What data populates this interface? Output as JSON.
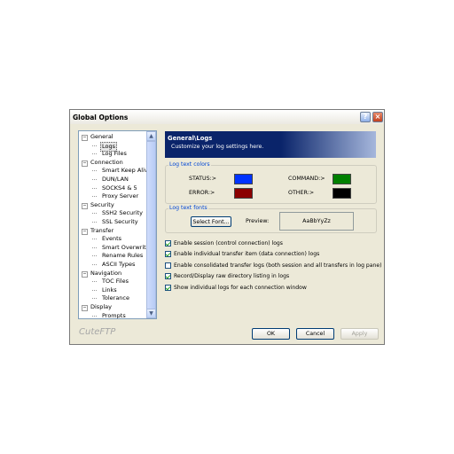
{
  "window": {
    "title": "Global Options",
    "help_label": "?",
    "close_label": "×"
  },
  "tree": {
    "items": [
      {
        "label": "General",
        "level": 0,
        "expanded": true
      },
      {
        "label": "Logs",
        "level": 1,
        "selected": true
      },
      {
        "label": "Log Files",
        "level": 1
      },
      {
        "label": "Connection",
        "level": 0,
        "expanded": true
      },
      {
        "label": "Smart Keep Alive",
        "level": 1
      },
      {
        "label": "DUN/LAN",
        "level": 1
      },
      {
        "label": "SOCKS4 & 5",
        "level": 1
      },
      {
        "label": "Proxy Server",
        "level": 1
      },
      {
        "label": "Security",
        "level": 0,
        "expanded": true
      },
      {
        "label": "SSH2 Security",
        "level": 1
      },
      {
        "label": "SSL Security",
        "level": 1
      },
      {
        "label": "Transfer",
        "level": 0,
        "expanded": true
      },
      {
        "label": "Events",
        "level": 1
      },
      {
        "label": "Smart Overwrite",
        "level": 1
      },
      {
        "label": "Rename Rules",
        "level": 1
      },
      {
        "label": "ASCII Types",
        "level": 1
      },
      {
        "label": "Navigation",
        "level": 0,
        "expanded": true
      },
      {
        "label": "TOC Files",
        "level": 1
      },
      {
        "label": "Links",
        "level": 1
      },
      {
        "label": "Tolerance",
        "level": 1
      },
      {
        "label": "Display",
        "level": 0,
        "expanded": true
      },
      {
        "label": "Prompts",
        "level": 1
      }
    ],
    "expander_label": "−",
    "scroll_up": "▲",
    "scroll_down": "▼"
  },
  "header": {
    "title": "General\\Logs",
    "subtitle": "Customize your log settings here."
  },
  "log_colors": {
    "legend": "Log text colors",
    "status_label": "STATUS:>",
    "status_color": "#0033ff",
    "command_label": "COMMAND:>",
    "command_color": "#008000",
    "error_label": "ERROR:>",
    "error_color": "#8b0000",
    "other_label": "OTHER:>",
    "other_color": "#000000"
  },
  "log_fonts": {
    "legend": "Log text fonts",
    "select_font_label": "Select Font...",
    "preview_label": "Preview:",
    "preview_sample": "AaBbYyZz"
  },
  "options": [
    {
      "label": "Enable session (control connection) logs",
      "checked": true
    },
    {
      "label": "Enable individual transfer item (data connection) logs",
      "checked": true
    },
    {
      "label": "Enable consolidated transfer logs (both session and all transfers in log pane)",
      "checked": false
    },
    {
      "label": "Record/Display raw directory listing in logs",
      "checked": true
    },
    {
      "label": "Show individual logs for each connection window",
      "checked": true
    }
  ],
  "footer": {
    "brand": "CuteFTP",
    "ok_label": "OK",
    "cancel_label": "Cancel",
    "apply_label": "Apply"
  }
}
